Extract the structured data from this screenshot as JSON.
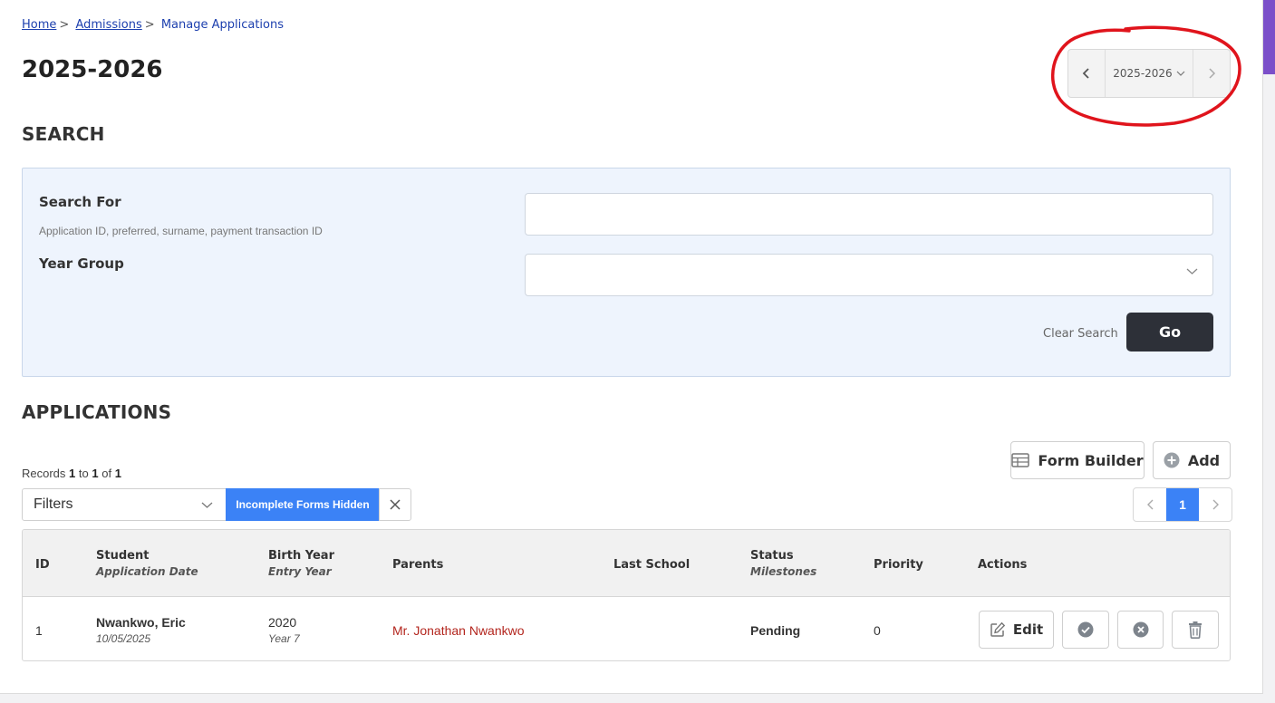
{
  "breadcrumb": {
    "home": "Home",
    "admissions": "Admissions",
    "current": "Manage Applications",
    "separator": ">"
  },
  "page_title": "2025-2026",
  "year_nav": {
    "selected": "2025-2026",
    "prev_icon": "chevron-left-icon",
    "next_icon": "chevron-right-icon"
  },
  "search": {
    "section_title": "SEARCH",
    "search_for_label": "Search For",
    "search_for_hint": "Application ID, preferred, surname, payment transaction ID",
    "search_for_value": "",
    "year_group_label": "Year Group",
    "year_group_value": "",
    "clear_label": "Clear Search",
    "go_label": "Go"
  },
  "applications": {
    "section_title": "APPLICATIONS",
    "records": {
      "prefix": "Records",
      "from": "1",
      "to_word": "to",
      "to": "1",
      "of_word": "of",
      "total": "1"
    },
    "form_builder_label": "Form Builder",
    "add_label": "Add",
    "filters_label": "Filters",
    "active_filter": "Incomplete Forms Hidden",
    "pager": {
      "current": "1"
    },
    "columns": {
      "id": "ID",
      "student": "Student",
      "student_sub": "Application Date",
      "birth_year": "Birth Year",
      "birth_year_sub": "Entry Year",
      "parents": "Parents",
      "last_school": "Last School",
      "status": "Status",
      "status_sub": "Milestones",
      "priority": "Priority",
      "actions": "Actions"
    },
    "rows": [
      {
        "id": "1",
        "student": "Nwankwo, Eric",
        "application_date": "10/05/2025",
        "birth_year": "2020",
        "entry_year": "Year 7",
        "parents": "Mr. Jonathan Nwankwo",
        "last_school": "",
        "status": "Pending",
        "priority": "0",
        "edit_label": "Edit"
      }
    ]
  },
  "colors": {
    "accent_blue": "#3b82f6",
    "link_blue": "#1c3fae",
    "parent_red": "#b3261e",
    "panel_bg": "#eef4fd",
    "go_dark": "#2d3038",
    "annotation_red": "#e0141c"
  }
}
